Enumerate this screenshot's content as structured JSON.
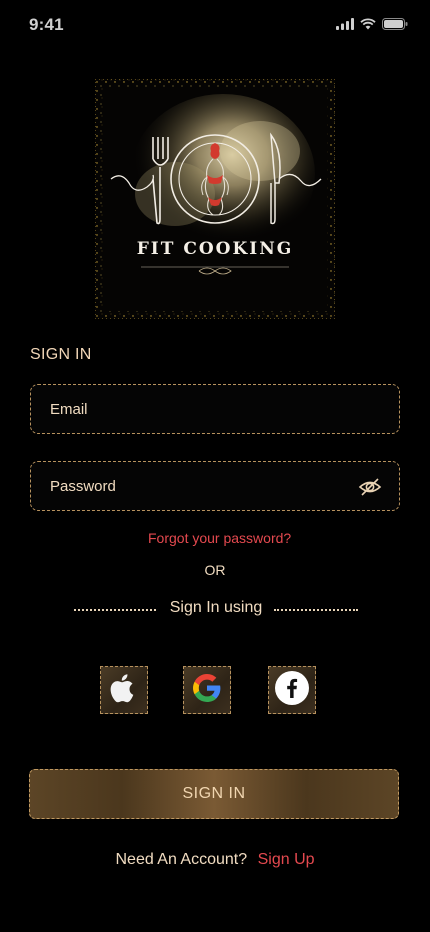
{
  "status_bar": {
    "time": "9:41",
    "icons": [
      "cellular-signal-icon",
      "wifi-icon",
      "battery-icon"
    ]
  },
  "logo": {
    "brand_text": "FIT COOKING",
    "icons": [
      "fork-icon",
      "plate-icon",
      "knife-icon",
      "woman-figure-icon"
    ]
  },
  "form": {
    "heading": "SIGN IN",
    "email_placeholder": "Email",
    "password_placeholder": "Password",
    "password_toggle_icon": "eye-off-icon",
    "forgot_password": "Forgot your password?",
    "or": "OR",
    "sign_in_using": "Sign In using"
  },
  "social": [
    {
      "name": "apple",
      "icon": "apple-icon"
    },
    {
      "name": "google",
      "icon": "google-icon"
    },
    {
      "name": "facebook",
      "icon": "facebook-icon"
    }
  ],
  "actions": {
    "sign_in_button": "SIGN IN",
    "need_account": "Need An Account?",
    "sign_up": "Sign Up"
  },
  "colors": {
    "background": "#000000",
    "gold_border": "#b7925e",
    "accent_red": "#e4494f",
    "text": "#f1dcc1"
  }
}
